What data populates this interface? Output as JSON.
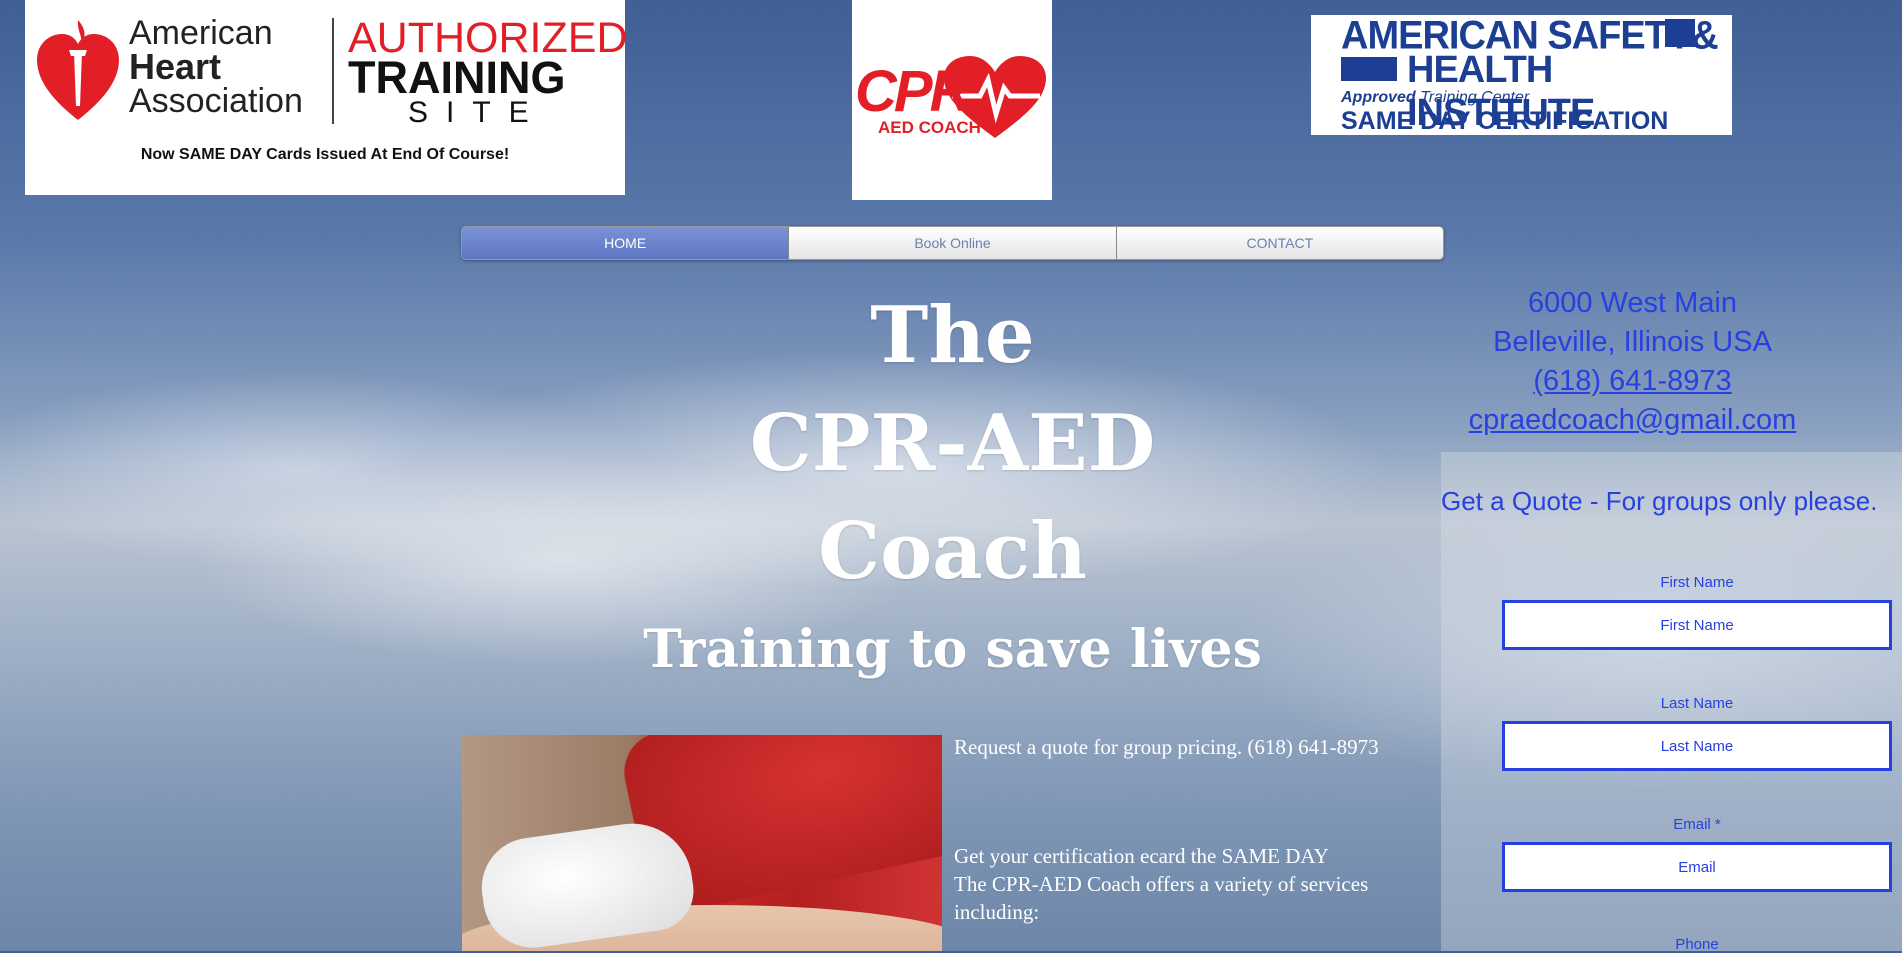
{
  "logos": {
    "aha": {
      "name_lines": [
        "American",
        "Heart",
        "Association"
      ],
      "authorized": "AUTHORIZED",
      "training": "TRAINING",
      "site": "SITE",
      "note": "Now SAME DAY Cards Issued At End Of Course!"
    },
    "cpr": {
      "text": "CPR",
      "sub": "AED COACH"
    },
    "ashi": {
      "line1": "AMERICAN SAFETY&",
      "line2": "HEALTH INSTITUTE",
      "approved_bold": "Approved",
      "approved_rest": " Training Center",
      "same_day": "SAME DAY CERTIFICATION"
    }
  },
  "nav": {
    "items": [
      {
        "label": "HOME",
        "active": true
      },
      {
        "label": "Book Online",
        "active": false
      },
      {
        "label": "CONTACT",
        "active": false
      }
    ]
  },
  "hero": {
    "lines": [
      "The",
      "CPR-AED",
      "Coach"
    ],
    "tagline": "Training to save lives"
  },
  "contact": {
    "street": "6000 West Main",
    "city": "Belleville, Illinois  USA",
    "phone": "(618) 641-8973",
    "email": "cpraedcoach@gmail.com"
  },
  "quote_form": {
    "title": "Get a Quote - For groups only please.",
    "fields": [
      {
        "label": "First Name",
        "placeholder": "First Name"
      },
      {
        "label": "Last Name",
        "placeholder": "Last Name"
      },
      {
        "label": "Email *",
        "placeholder": "Email"
      },
      {
        "label": "Phone"
      }
    ]
  },
  "info": {
    "quote_line": "Request a quote for group pricing.  (618) 641-8973",
    "cert_line": "Get your certification ecard the SAME DAY",
    "services_line": "The CPR-AED Coach offers a variety of services including:"
  },
  "colors": {
    "accent_blue": "#2741e0",
    "aha_red": "#e21f26",
    "ashi_blue": "#1c3f94",
    "nav_active": "#6a82cc"
  }
}
